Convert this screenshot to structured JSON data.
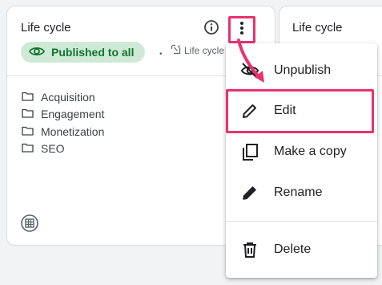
{
  "card": {
    "title": "Life cycle",
    "badge_label": "Published to all",
    "collection_label": "Life cycle",
    "folders": [
      {
        "label": "Acquisition"
      },
      {
        "label": "Engagement"
      },
      {
        "label": "Monetization"
      },
      {
        "label": "SEO"
      }
    ]
  },
  "card2": {
    "title": "Life cycle"
  },
  "menu": {
    "unpublish_label": "Unpublish",
    "edit_label": "Edit",
    "copy_label": "Make a copy",
    "rename_label": "Rename",
    "delete_label": "Delete"
  },
  "colors": {
    "highlight": "#e8336e",
    "badge_bg": "#ceead6",
    "badge_text": "#137333"
  },
  "icons": {
    "info": "info-icon",
    "more": "more-vert-icon",
    "eye": "eye-icon",
    "collection": "collection-icon",
    "folder": "folder-icon",
    "globe": "globe-icon",
    "unpublish": "unpublish-icon",
    "edit": "pencil-icon",
    "copy": "copy-icon",
    "rename": "pencil-icon",
    "delete": "trash-icon"
  }
}
